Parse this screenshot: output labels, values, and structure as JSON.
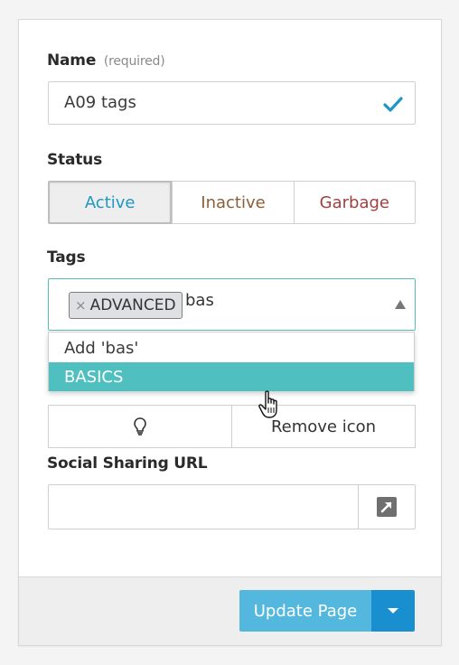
{
  "form": {
    "name_label": "Name",
    "name_required": "(required)",
    "name_value": "A09 tags",
    "status_label": "Status",
    "status_options": [
      "Active",
      "Inactive",
      "Garbage"
    ],
    "status_selected": "Active",
    "tags_label": "Tags",
    "tags": [
      "ADVANCED"
    ],
    "tag_remove_glyph": "×",
    "tags_query": "bas",
    "tags_dropdown": [
      "Add 'bas'",
      "BASICS"
    ],
    "tags_highlighted": "BASICS",
    "icon_button_label": "Remove icon",
    "social_label": "Social Sharing URL",
    "social_value": ""
  },
  "footer": {
    "update_label": "Update Page"
  },
  "colors": {
    "accent": "#1e96c6",
    "highlight": "#50bfbf",
    "update_button": "#54b8de",
    "split_button": "#1a8fcf",
    "inactive": "#8a5f38",
    "garbage": "#a0413f",
    "check": "#1e96c6"
  },
  "icons": {
    "check": "check-icon",
    "caret": "caret-up-icon",
    "bulb": "lightbulb-icon",
    "open": "external-link-icon",
    "cursor": "hand-pointer-icon",
    "dropdown": "chevron-down-icon"
  }
}
